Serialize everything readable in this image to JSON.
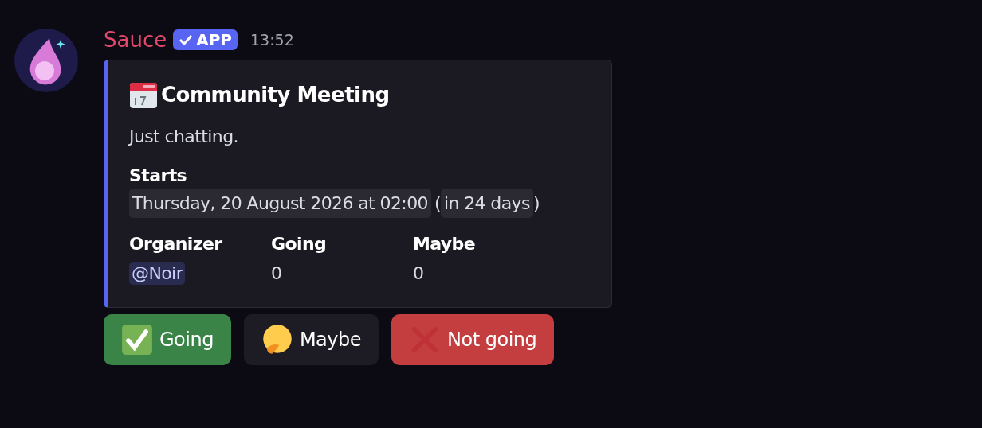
{
  "message": {
    "author": "Sauce",
    "badge": "APP",
    "time": "13:52"
  },
  "embed": {
    "title": "Community Meeting",
    "description": "Just chatting.",
    "starts": {
      "label": "Starts",
      "timestamp": "Thursday, 20 August 2026 at 02:00",
      "open": "(",
      "relative": "in 24 days",
      "close": ")"
    },
    "fields": [
      {
        "name": "Organizer",
        "value": "@Noir",
        "kind": "mention"
      },
      {
        "name": "Going",
        "value": "0",
        "kind": "text"
      },
      {
        "name": "Maybe",
        "value": "0",
        "kind": "text"
      }
    ]
  },
  "buttons": [
    {
      "label": "Going",
      "kind": "yes"
    },
    {
      "label": "Maybe",
      "kind": "maybe"
    },
    {
      "label": "Not going",
      "kind": "no"
    }
  ]
}
